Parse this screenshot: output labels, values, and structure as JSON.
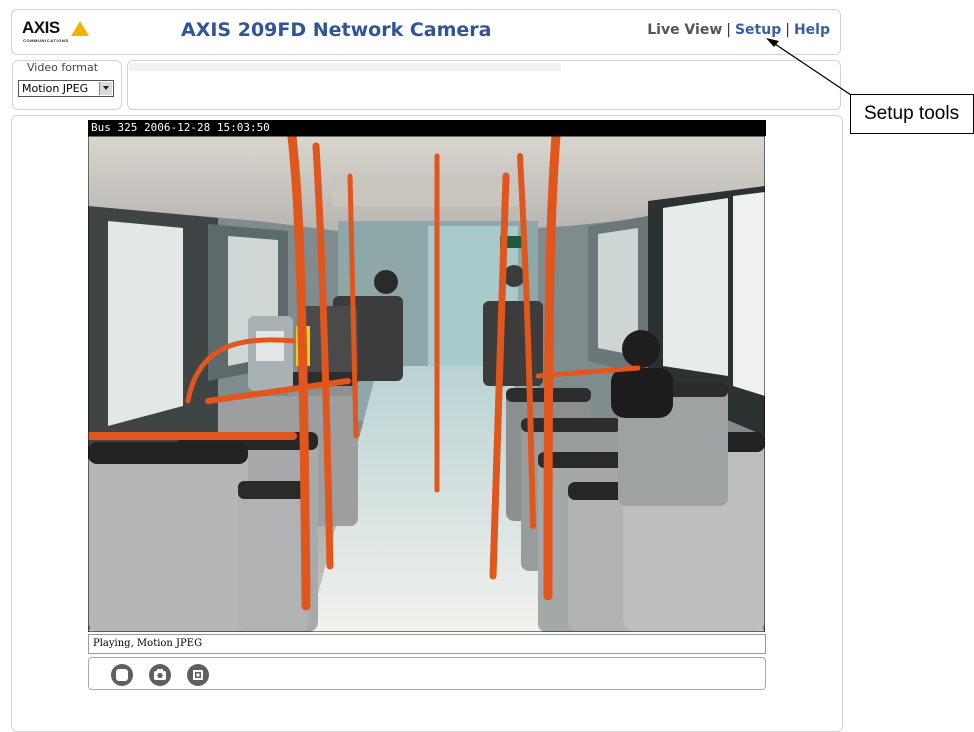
{
  "header": {
    "logo_text": "AXIS",
    "logo_sub": "COMMUNICATIONS",
    "title": "AXIS 209FD Network Camera",
    "nav": {
      "live_view": "Live View",
      "setup": "Setup",
      "help": "Help",
      "sep": "|"
    }
  },
  "video_format": {
    "label": "Video format",
    "selected": "Motion JPEG"
  },
  "stream": {
    "overlay_text": "Bus 325 2006-12-28 15:03:50",
    "status_text": "Playing, Motion JPEG"
  },
  "controls": {
    "buttons": [
      "stop",
      "snapshot",
      "fullscreen"
    ]
  },
  "callout": {
    "text": "Setup tools"
  },
  "colors": {
    "title": "#2f5597",
    "link": "#3c5ea8",
    "logo_triangle": "#f6b400",
    "pole_orange": "#e0561c",
    "seat_grey": "#9a9a9a"
  }
}
